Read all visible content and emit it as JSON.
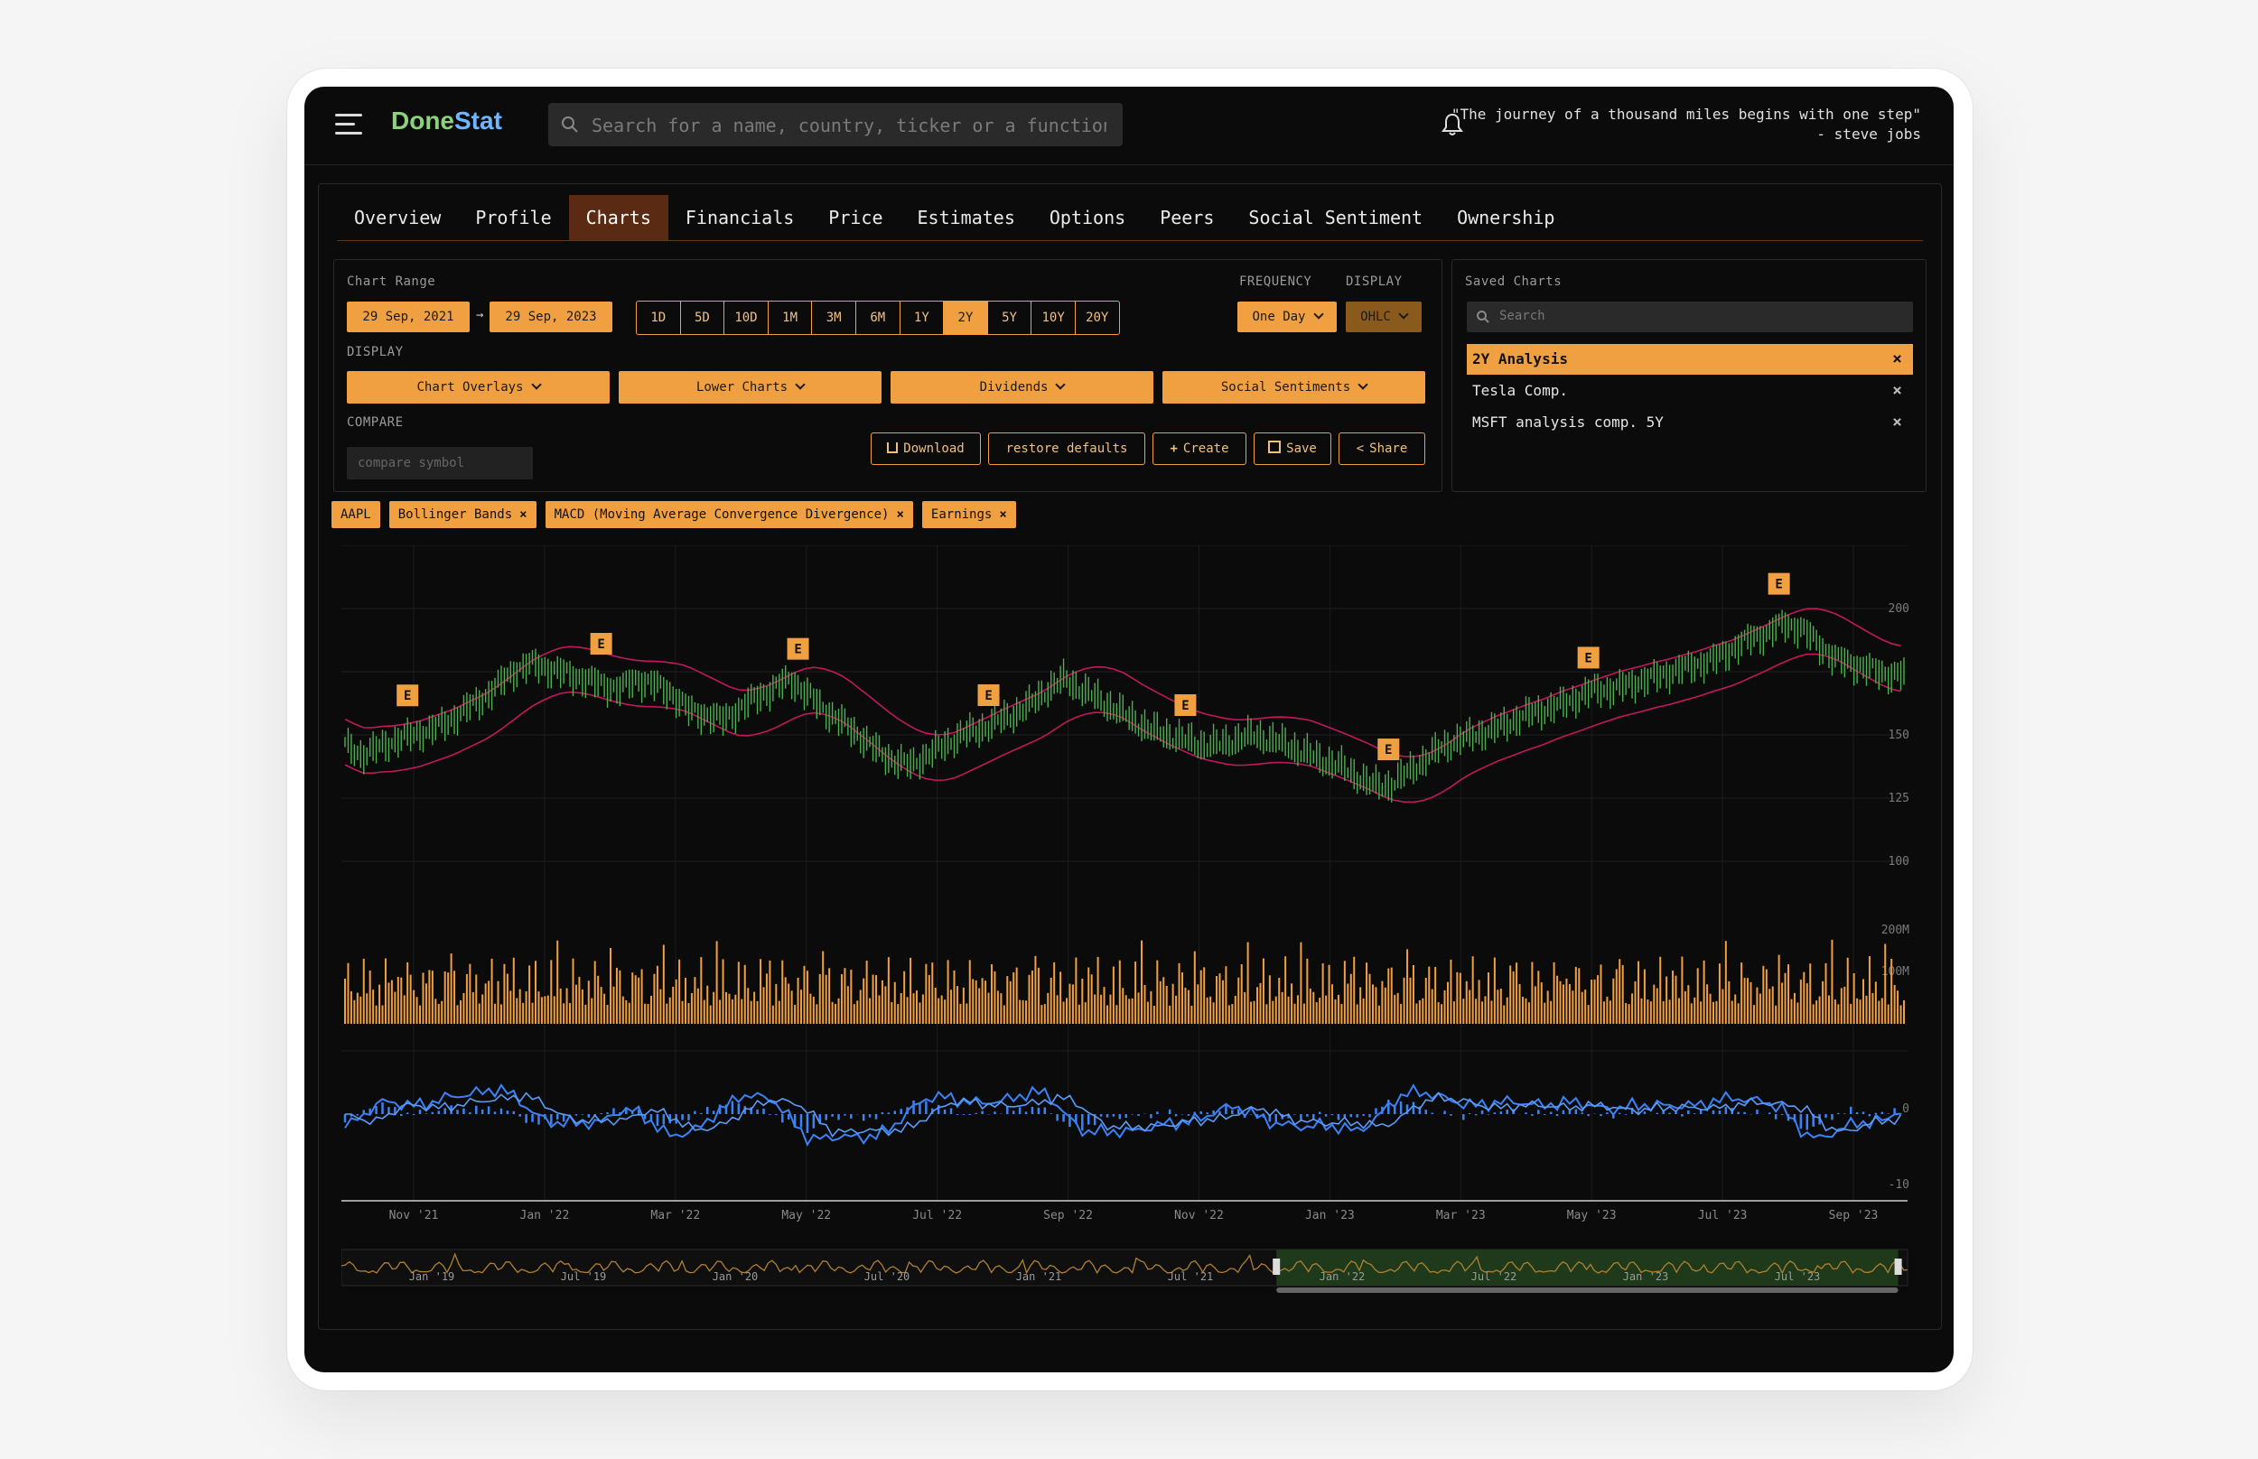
{
  "app": {
    "logo_part1": "Done",
    "logo_part2": "Stat",
    "search_placeholder": "Search for a name, country, ticker or a function",
    "quote_line1": "\"The journey of a thousand miles begins with one step\"",
    "quote_line2": "- steve jobs"
  },
  "tabs": [
    "Overview",
    "Profile",
    "Charts",
    "Financials",
    "Price",
    "Estimates",
    "Options",
    "Peers",
    "Social Sentiment",
    "Ownership"
  ],
  "active_tab": "Charts",
  "controls": {
    "chart_range_label": "Chart Range",
    "start_date": "29 Sep, 2021",
    "arrow": "→",
    "end_date": "29 Sep, 2023",
    "ranges": [
      "1D",
      "5D",
      "10D",
      "1M",
      "3M",
      "6M",
      "1Y",
      "2Y",
      "5Y",
      "10Y",
      "20Y"
    ],
    "active_range": "2Y",
    "frequency_label": "FREQUENCY",
    "frequency_value": "One Day",
    "display_label_right": "DISPLAY",
    "display_value": "OHLC",
    "display_label": "DISPLAY",
    "display_buttons": [
      "Chart Overlays",
      "Lower Charts",
      "Dividends",
      "Social Sentiments"
    ],
    "compare_label": "COMPARE",
    "compare_placeholder": "compare symbol",
    "download": "Download",
    "restore": "restore defaults",
    "create": "Create",
    "save": "Save",
    "share": "Share"
  },
  "saved_charts": {
    "title": "Saved Charts",
    "search_placeholder": "Search",
    "items": [
      "2Y Analysis",
      "Tesla Comp.",
      "MSFT analysis comp. 5Y"
    ],
    "active": "2Y Analysis"
  },
  "chips": [
    "AAPL",
    "Bollinger Bands",
    "MACD (Moving Average Convergence Divergence)",
    "Earnings"
  ],
  "chart_data": {
    "type": "line",
    "price_axis_ticks": [
      200,
      150,
      125,
      100
    ],
    "volume_axis_ticks": [
      "200M",
      "100M"
    ],
    "macd_axis_ticks": [
      0,
      -10
    ],
    "x_ticks": [
      "Nov '21",
      "Jan '22",
      "Mar '22",
      "May '22",
      "Jul '22",
      "Sep '22",
      "Nov '22",
      "Jan '23",
      "Mar '23",
      "May '23",
      "Jul '23",
      "Sep '23"
    ],
    "navigator_ticks": [
      "Jan '19",
      "Jul '19",
      "Jan '20",
      "Jul '20",
      "Jan '21",
      "Jul '21",
      "Jan '22",
      "Jul '22",
      "Jan '23",
      "Jul '23"
    ],
    "earnings_marker": "E",
    "earnings_dates": [
      "Oct '21",
      "Jan '22",
      "Apr '22",
      "Jul '22",
      "Oct '22",
      "Feb '23",
      "May '23",
      "Aug '23"
    ],
    "price_series": [
      146,
      142,
      145,
      148,
      150,
      152,
      155,
      160,
      164,
      170,
      176,
      178,
      176,
      174,
      172,
      170,
      168,
      172,
      170,
      167,
      160,
      158,
      156,
      160,
      165,
      168,
      172,
      166,
      160,
      155,
      150,
      144,
      140,
      138,
      142,
      146,
      150,
      152,
      155,
      158,
      162,
      168,
      172,
      168,
      164,
      160,
      156,
      152,
      150,
      148,
      146,
      146,
      148,
      150,
      148,
      146,
      143,
      140,
      138,
      134,
      130,
      130,
      135,
      140,
      145,
      148,
      150,
      152,
      155,
      158,
      160,
      162,
      165,
      168,
      168,
      170,
      172,
      174,
      176,
      178,
      180,
      184,
      188,
      190,
      194,
      192,
      186,
      180,
      178,
      176,
      174,
      174
    ]
  },
  "colors": {
    "accent": "#f0a040",
    "active_tab": "#5a2b12",
    "band": "#c2185b",
    "candle_up": "#4caf50",
    "macd": "#3b82f6",
    "logo_green": "#8bd27a",
    "logo_blue": "#6fb6ff"
  }
}
